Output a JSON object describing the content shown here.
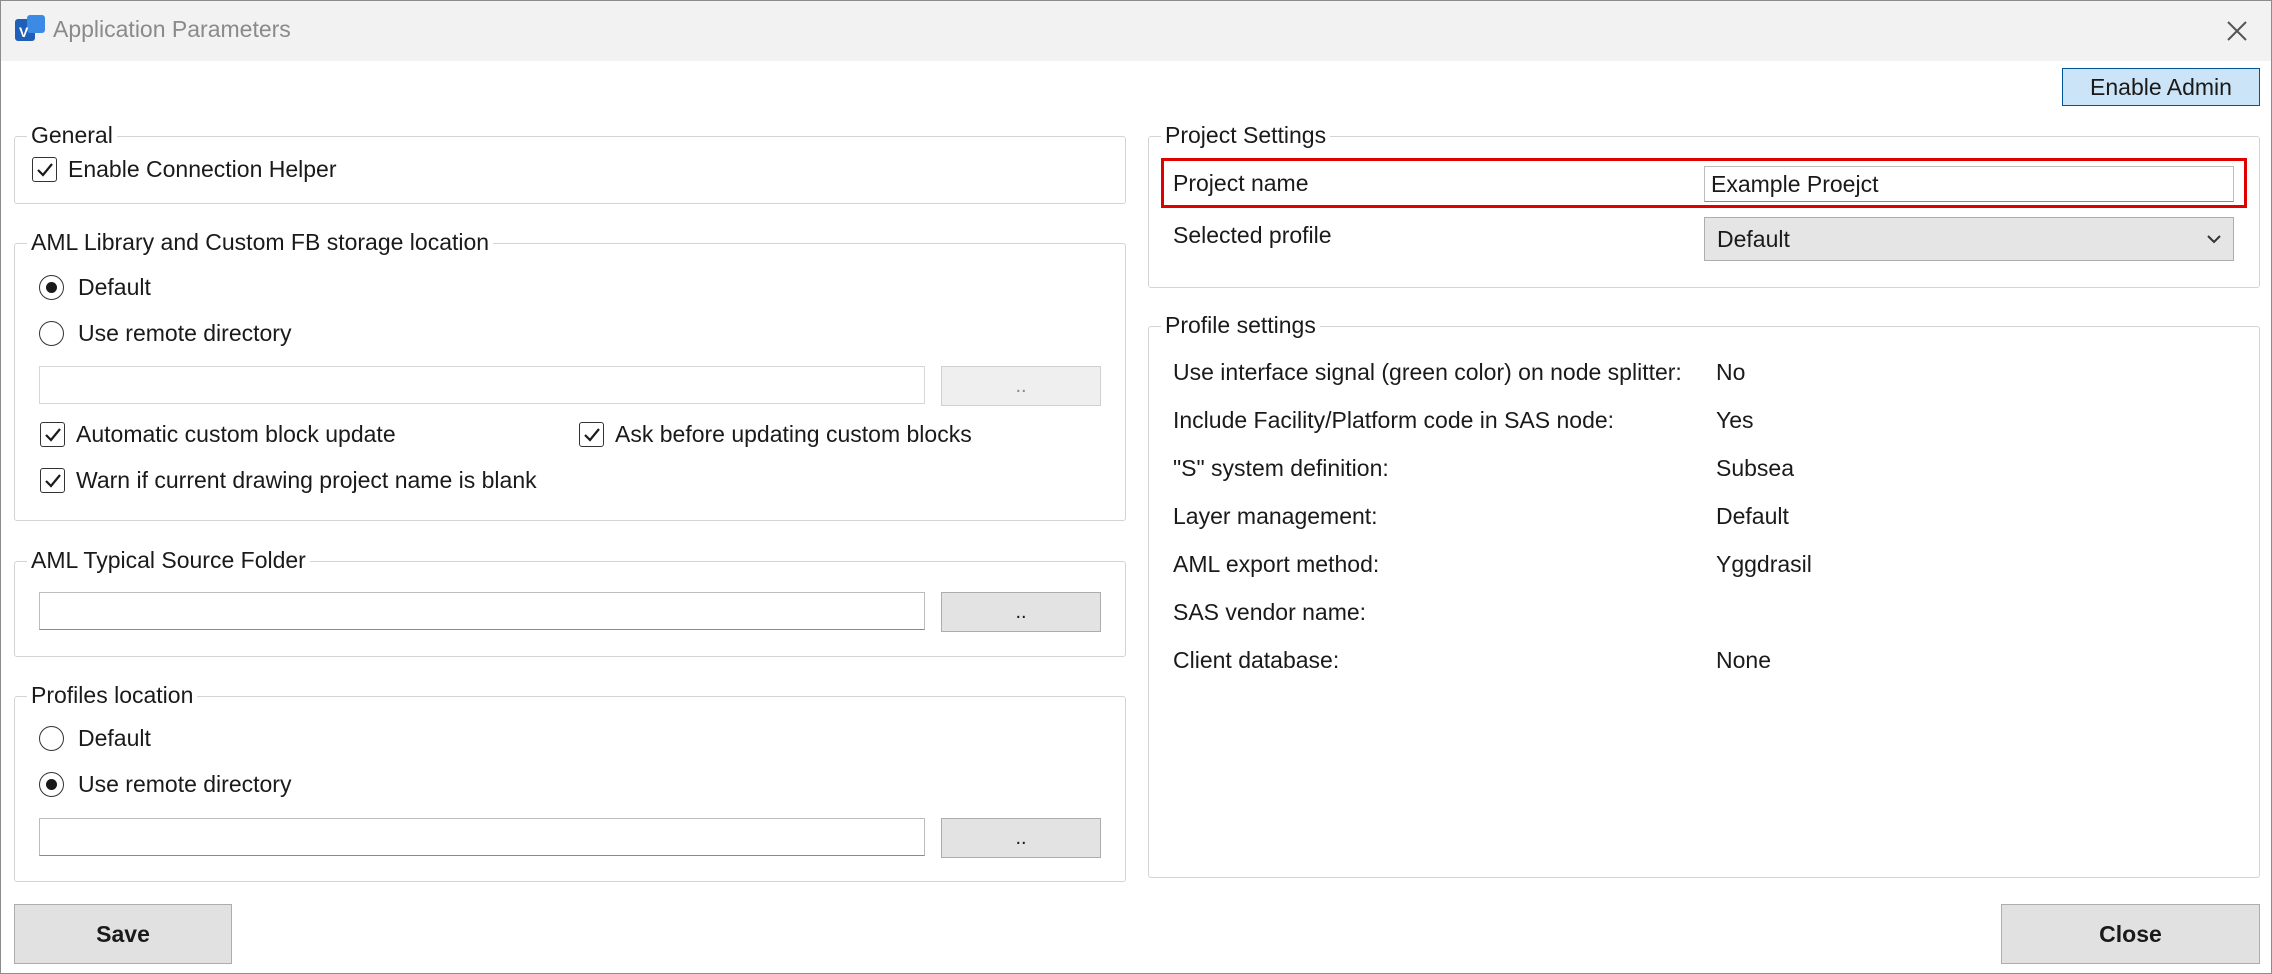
{
  "window": {
    "title": "Application Parameters"
  },
  "toolbar": {
    "enable_admin_label": "Enable Admin"
  },
  "general": {
    "legend": "General",
    "connection_helper": {
      "label": "Enable Connection Helper",
      "checked": true
    }
  },
  "aml_library": {
    "legend": "AML Library and Custom FB storage location",
    "radio_default": {
      "label": "Default",
      "selected": true
    },
    "radio_remote": {
      "label": "Use remote directory",
      "selected": false
    },
    "path_value": "",
    "browse_label": "..",
    "auto_update": {
      "label": "Automatic custom block update",
      "checked": true
    },
    "ask_before": {
      "label": "Ask before updating custom blocks",
      "checked": true
    },
    "warn_blank": {
      "label": "Warn if current drawing project name is blank",
      "checked": true
    }
  },
  "aml_typical": {
    "legend": "AML Typical Source Folder",
    "path_value": "",
    "browse_label": ".."
  },
  "profiles_location": {
    "legend": "Profiles location",
    "radio_default": {
      "label": "Default",
      "selected": false
    },
    "radio_remote": {
      "label": "Use remote directory",
      "selected": true
    },
    "path_value": "",
    "browse_label": ".."
  },
  "project_settings": {
    "legend": "Project Settings",
    "project_name_label": "Project name",
    "project_name_value": "Example Proejct",
    "selected_profile_label": "Selected profile",
    "selected_profile_value": "Default"
  },
  "profile_settings": {
    "legend": "Profile settings",
    "rows": [
      {
        "label": "Use interface signal (green color) on node splitter:",
        "value": "No"
      },
      {
        "label": "Include Facility/Platform code in SAS node:",
        "value": "Yes"
      },
      {
        "label": "\"S\" system definition:",
        "value": "Subsea"
      },
      {
        "label": "Layer management:",
        "value": "Default"
      },
      {
        "label": "AML export method:",
        "value": "Yggdrasil"
      },
      {
        "label": "SAS vendor name:",
        "value": ""
      },
      {
        "label": "Client database:",
        "value": "None"
      }
    ]
  },
  "footer": {
    "save_label": "Save",
    "close_label": "Close"
  },
  "colors": {
    "highlight": "#e00000",
    "admin_button_bg": "#cce4f7",
    "admin_button_border": "#005499"
  }
}
